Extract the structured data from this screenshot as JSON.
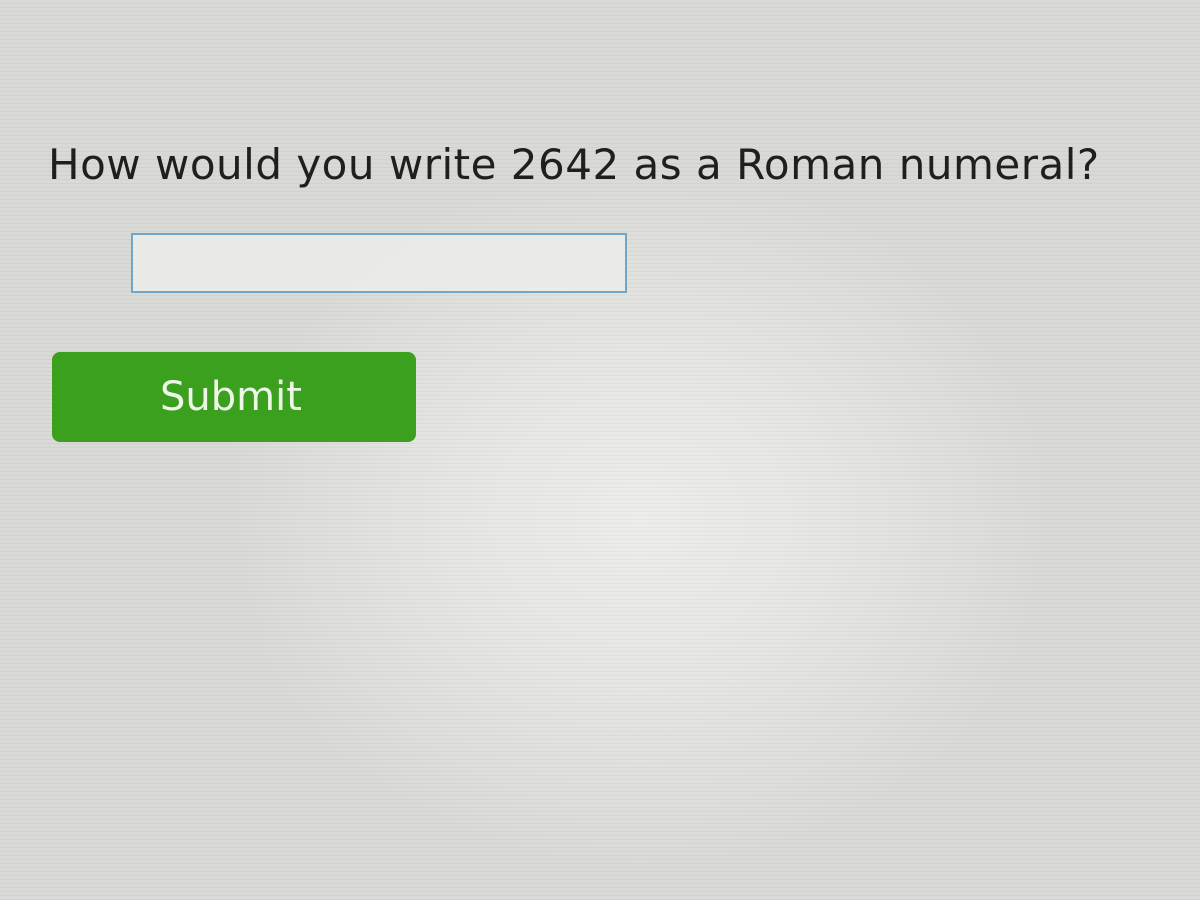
{
  "question": {
    "text": "How would you write 2642 as a Roman numeral?"
  },
  "answer": {
    "value": "",
    "placeholder": ""
  },
  "submit": {
    "label": "Submit"
  },
  "colors": {
    "submit_background": "#3aa01d",
    "input_border": "#6fa6c9",
    "question_text": "#1f1f1f"
  }
}
